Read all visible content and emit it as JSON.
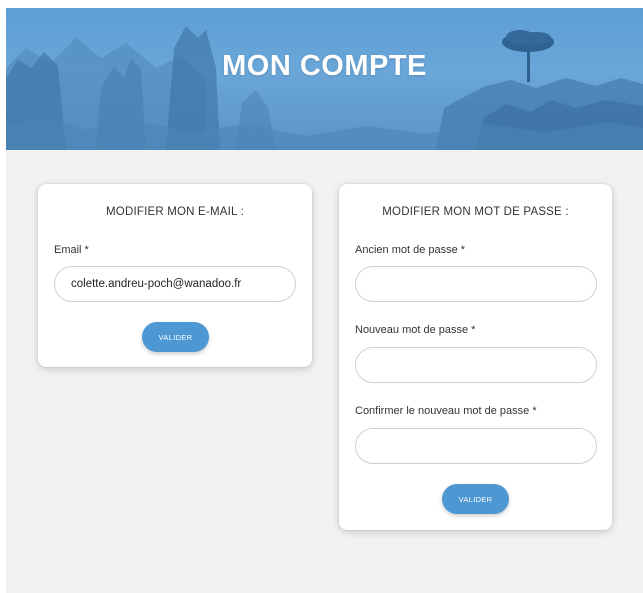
{
  "header": {
    "title": "MON COMPTE"
  },
  "email_card": {
    "title": "MODIFIER MON E-MAIL :",
    "email_label": "Email *",
    "email_value": "colette.andreu-poch@wanadoo.fr",
    "submit_label": "VALIDER"
  },
  "password_card": {
    "title": "MODIFIER MON MOT DE PASSE :",
    "old_label": "Ancien mot de passe *",
    "new_label": "Nouveau mot de passe *",
    "confirm_label": "Confirmer le nouveau mot de passe *",
    "submit_label": "VALIDER"
  },
  "colors": {
    "accent": "#4d97d3",
    "banner": "#5d9fd5",
    "page_background": "#f2f2f2"
  }
}
